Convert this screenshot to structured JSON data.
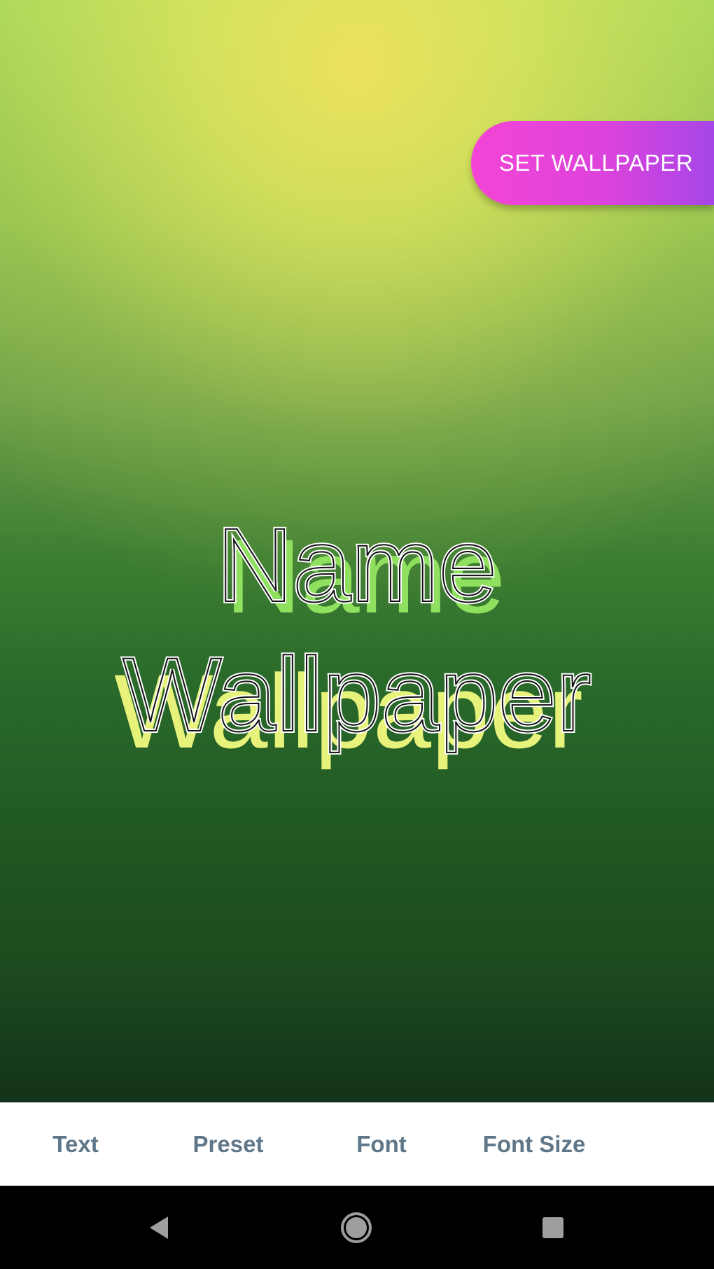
{
  "preview": {
    "set_wallpaper_label": "SET WALLPAPER",
    "text_lines": [
      "Name",
      "Wallpaper"
    ],
    "colors": {
      "line1_shadow": "#8fe05e",
      "line2_shadow": "#e7f27a",
      "text_stroke": "#ffffff",
      "button_gradient_start": "#f444d6",
      "button_gradient_end": "#a746e8"
    }
  },
  "tabs": [
    {
      "label": "Text"
    },
    {
      "label": "Preset"
    },
    {
      "label": "Font"
    },
    {
      "label": "Font Size"
    }
  ],
  "nav": {
    "back_icon": "back-triangle-icon",
    "home_icon": "home-circle-icon",
    "recents_icon": "recents-square-icon"
  }
}
